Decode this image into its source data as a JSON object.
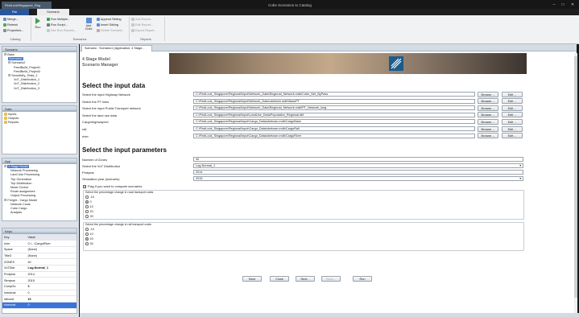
{
  "window": {
    "doc_tab": "FirstLookSingapore_Rsg",
    "title": "Cube Scenarios to Catalog",
    "controls": [
      "–",
      "□",
      "✕"
    ]
  },
  "ribbon": {
    "file_tab": "File",
    "active_tab": "Scenario",
    "catalog_group": {
      "label": "Catalog",
      "items": [
        "Merge...",
        "Refresh",
        "Properties..."
      ]
    },
    "scenarios_group": {
      "label": "Scenarios",
      "run_label": "Run",
      "run_multiple": "Run Multiple...",
      "run_script": "Run Script...",
      "see_run_reports": "See Run Reports...",
      "add_child_label": "Add Child",
      "append_sibling": "Append Sibling",
      "insert_sibling": "Insert Sibling",
      "delete_scenario": "Delete Scenario"
    },
    "reports_group": {
      "label": "Reports",
      "add_report": "Add Report...",
      "edit_report": "Edit Report...",
      "export_report": "Export Report..."
    }
  },
  "panes": {
    "scenarios_title": "Scenario",
    "files_title": "Data",
    "apps_title": "App",
    "keys_title": "Keys"
  },
  "scenario_tree": [
    "Base",
    "Scenario1",
    "Scenario2",
    "FeedBuild_Project1",
    "FeedBuild_Project2",
    "Sensitivity_Tests_1",
    "VoT_Distribution_1",
    "VoT_Distribution_2",
    "VoT_Distribution_3"
  ],
  "files_tree": [
    "Inputs",
    "Outputs",
    "Reports"
  ],
  "app_tree": [
    "4 Stage Model",
    "Network Processing",
    "Land Use Processing",
    "Trip Generation",
    "Trip Distribution",
    "Mode Choice",
    "Route assignment",
    "Output Processing",
    "Freight - Cargo Model",
    "Network Costs",
    "Cube Cargo",
    "Analysis"
  ],
  "keys": {
    "col_key": "Key",
    "col_value": "Value",
    "rows": [
      [
        "river",
        "C:\\...\\CargoRiver"
      ],
      [
        "Space",
        "(None)"
      ],
      [
        "Title3",
        "(None)"
      ],
      [
        "ZONES",
        "40"
      ],
      [
        "VoTDist",
        "Log-Normal_1"
      ],
      [
        "Pmtyear",
        "2014"
      ],
      [
        "Simyear",
        "2015"
      ],
      [
        "CompSc",
        "$"
      ],
      [
        "roadcost",
        "0"
      ],
      [
        "railcost",
        "10"
      ],
      [
        "rivercost",
        "0"
      ]
    ]
  },
  "main": {
    "tab_label": "Scenario : Scenario1 (Application: 4 Stage...",
    "app_title": "4 Stage Model",
    "app_subtitle": "Scenario Manager",
    "input_data_heading": "Select the input data",
    "inputs": [
      {
        "label": "Select the input Highway Network",
        "path": "C:\\FirstLook_Singapore\\Regional\\Input\\Network_Data\\Regional_Network.mdb\\Cube_Net_ByPass"
      },
      {
        "label": "Select the PT lines",
        "path": "C:\\FirstLook_Singapore\\Regional\\Input\\Network_Data\\ubetown.mdb\\BasePT"
      },
      {
        "label": "Select the input Public Transport network",
        "path": "C:\\FirstLook_Singapore\\Regional\\Input\\Network_Data\\Regional_Network.mdb\\PT_Network_long"
      },
      {
        "label": "Select the land use data",
        "path": "C:\\FirstLook_Singapore\\Regional\\Input\\LandUse_Data\\Population_Regional.dbf"
      },
      {
        "label": "Cargo\\highwayrrel",
        "path": "C:\\FirstLook_Singapore\\Regional\\Input\\Cargo_Data\\ubetown.mdb\\CargoBase"
      },
      {
        "label": "rail",
        "path": "C:\\FirstLook_Singapore\\Regional\\Input\\Cargo_Data\\ubetown.mdb\\CargoRail"
      },
      {
        "label": "river",
        "path": "C:\\FirstLook_Singapore\\Regional\\Input\\Cargo_Data\\ubetown.mdb\\CargoRiver"
      }
    ],
    "browse_label": "Browse ...",
    "edit_label": "Edit ...",
    "params_heading": "Select the input parameters",
    "params": [
      {
        "label": "Number of Zones",
        "value": "40"
      },
      {
        "label": "Select the VoT Distribution",
        "value": "Log-Normal_1"
      },
      {
        "label": "Pmtyear",
        "value": "2014"
      },
      {
        "label": "Simulation year (scenario)",
        "value": "2015"
      }
    ],
    "compare_flag": "Flag if you want to compare scenarios",
    "road_group_label": "Select the percentage change in road transport costs",
    "road_options": [
      "-10",
      "0",
      "10",
      "20",
      "30"
    ],
    "rail_group_label": "Select the percentage change in rail transport costs",
    "rail_options": [
      "-10",
      "10",
      "20",
      "30"
    ],
    "buttons": {
      "save": "Save",
      "close": "Close",
      "next": "Next...",
      "back": "Back...",
      "run": "Run"
    }
  }
}
